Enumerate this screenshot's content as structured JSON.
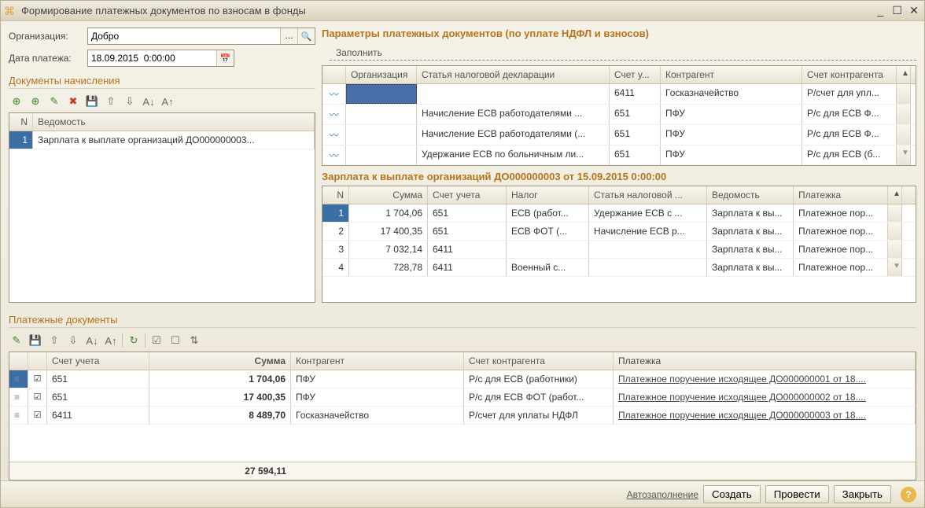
{
  "window": {
    "title": "Формирование платежных документов по взносам в фонды"
  },
  "fields": {
    "org_label": "Организация:",
    "org_value": "Добро",
    "date_label": "Дата платежа:",
    "date_value": "18.09.2015  0:00:00"
  },
  "sections": {
    "accrual_title": "Документы начисления",
    "params_title": "Параметры платежных документов (по уплате НДФЛ и взносов)",
    "fill_label": "Заполнить",
    "salary_title": "Зарплата к выплате организаций ДО000000003 от 15.09.2015 0:00:00",
    "payments_title": "Платежные документы"
  },
  "accrual_table": {
    "headers": {
      "n": "N",
      "ved": "Ведомость"
    },
    "rows": [
      {
        "n": "1",
        "ved": "Зарплата к выплате организаций ДО000000003..."
      }
    ]
  },
  "params_table": {
    "headers": {
      "org": "Организация",
      "stat": "Статья налоговой декларации",
      "acc": "Счет у...",
      "ctr": "Контрагент",
      "cacc": "Счет контрагента"
    },
    "rows": [
      {
        "org": "",
        "stat": "",
        "acc": "6411",
        "ctr": "Госказначейство",
        "cacc": "Р/счет для упл..."
      },
      {
        "org": "",
        "stat": "Начисление ЕСВ работодателями ...",
        "acc": "651",
        "ctr": "ПФУ",
        "cacc": "Р/с для ЕСВ Ф..."
      },
      {
        "org": "",
        "stat": "Начисление ЕСВ работодателями (...",
        "acc": "651",
        "ctr": "ПФУ",
        "cacc": "Р/с для ЕСВ Ф..."
      },
      {
        "org": "",
        "stat": "Удержание ЕСВ по больничным ли...",
        "acc": "651",
        "ctr": "ПФУ",
        "cacc": "Р/с для ЕСВ (б..."
      }
    ]
  },
  "salary_table": {
    "headers": {
      "n": "N",
      "sum": "Сумма",
      "acc": "Счет учета",
      "tax": "Налог",
      "stat": "Статья налоговой ...",
      "ved": "Ведомость",
      "pay": "Платежка"
    },
    "rows": [
      {
        "n": "1",
        "sum": "1 704,06",
        "acc": "651",
        "tax": "ЕСВ (работ...",
        "stat": "Удержание ЕСВ с ...",
        "ved": "Зарплата к вы...",
        "pay": "Платежное пор..."
      },
      {
        "n": "2",
        "sum": "17 400,35",
        "acc": "651",
        "tax": "ЕСВ ФОТ (...",
        "stat": "Начисление ЕСВ р...",
        "ved": "Зарплата к вы...",
        "pay": "Платежное пор..."
      },
      {
        "n": "3",
        "sum": "7 032,14",
        "acc": "6411",
        "tax": "",
        "stat": "",
        "ved": "Зарплата к вы...",
        "pay": "Платежное пор..."
      },
      {
        "n": "4",
        "sum": "728,78",
        "acc": "6411",
        "tax": "Военный с...",
        "stat": "",
        "ved": "Зарплата к вы...",
        "pay": "Платежное пор..."
      }
    ]
  },
  "payments_table": {
    "headers": {
      "acc": "Счет учета",
      "sum": "Сумма",
      "ctr": "Контрагент",
      "cacc": "Счет контрагента",
      "pay": "Платежка"
    },
    "rows": [
      {
        "checked": true,
        "acc": "651",
        "sum": "1 704,06",
        "ctr": "ПФУ",
        "cacc": "Р/с для ЕСВ (работники)",
        "pay": "Платежное поручение исходящее ДО000000001 от 18...."
      },
      {
        "checked": true,
        "acc": "651",
        "sum": "17 400,35",
        "ctr": "ПФУ",
        "cacc": "Р/с для ЕСВ ФОТ (работ...",
        "pay": "Платежное поручение исходящее ДО000000002 от 18...."
      },
      {
        "checked": true,
        "acc": "6411",
        "sum": "8 489,70",
        "ctr": "Госказначейство",
        "cacc": "Р/счет для уплаты НДФЛ",
        "pay": "Платежное поручение исходящее ДО000000003 от 18...."
      }
    ],
    "total": "27 594,11"
  },
  "bottombar": {
    "autofill": "Автозаполнение",
    "create": "Создать",
    "post": "Провести",
    "close": "Закрыть"
  },
  "glyphs": {
    "checkbox_checked": "☑",
    "wave": "〰",
    "up": "▲",
    "down": "▼"
  }
}
